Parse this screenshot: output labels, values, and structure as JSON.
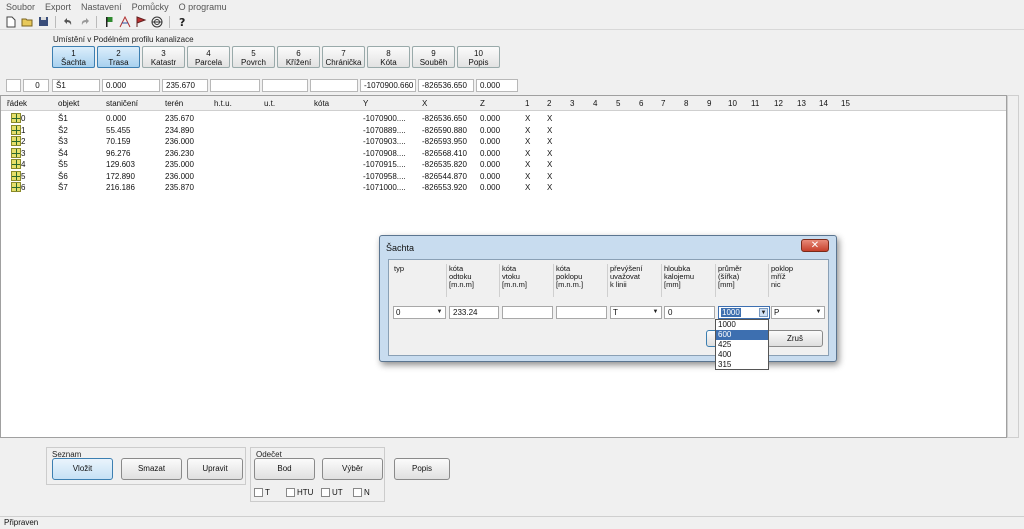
{
  "menu": [
    "Soubor",
    "Export",
    "Nastavení",
    "Pomůcky",
    "O programu"
  ],
  "toolbar_icons": [
    "new-file-icon",
    "open-folder-icon",
    "save-icon",
    "undo-icon",
    "redo-icon",
    "flag-p-icon",
    "measure-icon",
    "flag-icon",
    "target-icon",
    "help-icon"
  ],
  "placement_caption": "Umístění v Podélném profilu kanalizace",
  "tabs": [
    {
      "num": "1",
      "label": "Šachta"
    },
    {
      "num": "2",
      "label": "Trasa"
    },
    {
      "num": "3",
      "label": "Katastr"
    },
    {
      "num": "4",
      "label": "Parcela"
    },
    {
      "num": "5",
      "label": "Povrch"
    },
    {
      "num": "6",
      "label": "Křížení"
    },
    {
      "num": "7",
      "label": "Chránička"
    },
    {
      "num": "8",
      "label": "Kóta"
    },
    {
      "num": "9",
      "label": "Souběh"
    },
    {
      "num": "10",
      "label": "Popis"
    }
  ],
  "input_row": {
    "radek": "0",
    "objekt": "Š1",
    "staniceni": "0.000",
    "teren": "235.670",
    "y": "-1070900.660",
    "x": "-826536.650",
    "z": "0.000"
  },
  "table": {
    "headers": [
      "řádek",
      "objekt",
      "staničení",
      "terén",
      "h.t.u.",
      "u.t.",
      "kóta",
      "Y",
      "X",
      "Z",
      "1",
      "2",
      "3",
      "4",
      "5",
      "6",
      "7",
      "8",
      "9",
      "10",
      "11",
      "12",
      "13",
      "14",
      "15"
    ],
    "rows": [
      {
        "radek": "0",
        "objekt": "Š1",
        "staniceni": "0.000",
        "teren": "235.670",
        "y": "-1070900....",
        "x": "-826536.650",
        "z": "0.000",
        "c1": "X",
        "c2": "X"
      },
      {
        "radek": "1",
        "objekt": "Š2",
        "staniceni": "55.455",
        "teren": "234.890",
        "y": "-1070889....",
        "x": "-826590.880",
        "z": "0.000",
        "c1": "X",
        "c2": "X"
      },
      {
        "radek": "2",
        "objekt": "Š3",
        "staniceni": "70.159",
        "teren": "236.000",
        "y": "-1070903....",
        "x": "-826593.950",
        "z": "0.000",
        "c1": "X",
        "c2": "X"
      },
      {
        "radek": "3",
        "objekt": "Š4",
        "staniceni": "96.276",
        "teren": "236.230",
        "y": "-1070908....",
        "x": "-826568.410",
        "z": "0.000",
        "c1": "X",
        "c2": "X"
      },
      {
        "radek": "4",
        "objekt": "Š5",
        "staniceni": "129.603",
        "teren": "235.000",
        "y": "-1070915....",
        "x": "-826535.820",
        "z": "0.000",
        "c1": "X",
        "c2": "X"
      },
      {
        "radek": "5",
        "objekt": "Š6",
        "staniceni": "172.890",
        "teren": "236.000",
        "y": "-1070958....",
        "x": "-826544.870",
        "z": "0.000",
        "c1": "X",
        "c2": "X"
      },
      {
        "radek": "6",
        "objekt": "Š7",
        "staniceni": "216.186",
        "teren": "235.870",
        "y": "-1071000....",
        "x": "-826553.920",
        "z": "0.000",
        "c1": "X",
        "c2": "X"
      }
    ]
  },
  "dialog": {
    "title": "Šachta",
    "close": "✕",
    "headers": {
      "typ": "typ",
      "kota_odtoku": "kóta\nodtoku\n[m.n.m]",
      "kota_vtoku": "kóta\nvtoku\n[m.n.m]",
      "kota_poklopu": "kóta\npoklopu\n[m.n.m.]",
      "prevyseni": "převýšení\nuvažovat\nk linii",
      "hloubka": "hloubka\nkalojemu\n[mm]",
      "prumer": "průměr\n(šířka)\n[mm]",
      "poklop": "poklop\nmříž\nnic"
    },
    "values": {
      "typ": "0",
      "kota_odtoku": "233.24",
      "kota_vtoku": "",
      "kota_poklopu": "",
      "prevyseni": "T",
      "hloubka": "0",
      "prumer": "1000",
      "poklop": "P"
    },
    "cancel_label": "Zruš",
    "prumer_options": [
      "1000",
      "600",
      "425",
      "400",
      "315"
    ],
    "prumer_highlighted": "600"
  },
  "bottom": {
    "seznam_caption": "Seznam",
    "vlozit": "Vložit",
    "smazat": "Smazat",
    "upravit": "Upravit",
    "odecet_caption": "Odečet",
    "bod": "Bod",
    "vyber": "Výběr",
    "popis": "Popis",
    "checks": [
      "T",
      "HTU",
      "UT",
      "N"
    ]
  },
  "status": "Připraven"
}
